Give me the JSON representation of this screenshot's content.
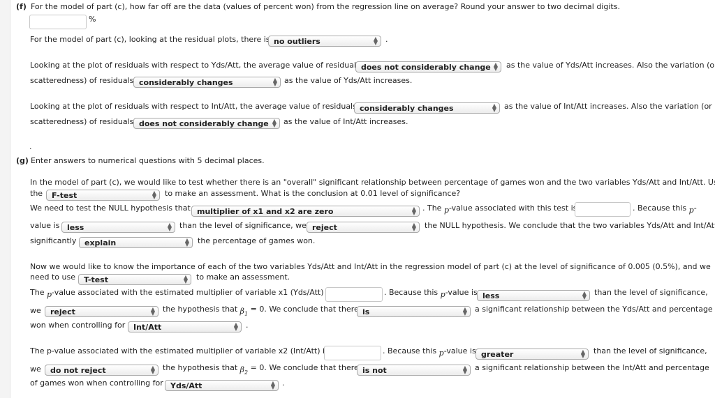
{
  "part_f": {
    "label": "(f)",
    "question": "For the model of part (c), how far off are the data (values of percent won) from the regression line on average? Round your answer to two decimal digits.",
    "answer_value": "",
    "percent_sign": "%",
    "outliers_prefix": "For the model of part (c), looking at the residual plots, there is",
    "outliers_select": "no outliers",
    "period": ".",
    "yds_line1_prefix": "Looking at the plot of residuals with respect to Yds/Att, the average value of residuals",
    "yds_avg_select": "does not considerably change",
    "yds_line1_suffix": "as the value of Yds/Att increases. Also the variation (or",
    "yds_line2_prefix": "scatteredness) of residuals",
    "yds_var_select": "considerably changes",
    "yds_line2_suffix": "as the value of Yds/Att increases.",
    "int_line1_prefix": "Looking at the plot of residuals with respect to Int/Att, the average value of residuals",
    "int_avg_select": "considerably changes",
    "int_line1_suffix": "as the value of Int/Att increases. Also the variation (or",
    "int_line2_prefix": "scatteredness) of residuals",
    "int_var_select": "does not considerably change",
    "int_line2_suffix": "as the value of Int/Att increases.",
    "dot": "."
  },
  "part_g": {
    "label": "(g)",
    "instruction": "Enter answers to numerical questions with 5 decimal places.",
    "overall_line1": "In the model of part (c), we would like to test whether there is an \"overall\" significant relationship between percentage of games won and the two variables Yds/Att and Int/Att. Use",
    "overall_the": "the",
    "test_select": "F-test",
    "overall_line2_suffix": "to make an assessment. What is the conclusion at 0.01 level of significance?",
    "null_prefix": "We need to test the NULL hypothesis that",
    "null_select": "multiplier of x1 and x2 are zero",
    "pvalue_prefix_a": ". The",
    "p_symbol": "p",
    "pvalue_prefix_b": "-value associated with this test is",
    "pvalue_input": "",
    "because_this": ". Because this",
    "dash": "-",
    "value_is": "value is",
    "compare_select": "less",
    "than_level_we": "than the level of significance, we",
    "decision_select": "reject",
    "null_conclusion": "the NULL hypothesis. We conclude that the two variables Yds/Att and Int/Att",
    "significantly": "significantly",
    "explain_select": "explain",
    "pct_games_won": "the percentage of games won.",
    "importance_line1": "Now we would like to know the importance of each of the two variables Yds/Att and Int/Att in the regression model of part (c) at the level of significance of 0.005 (0.5%), and we",
    "need_to_use": "need to use",
    "ttest_select": "T-test",
    "to_make": "to make an assessment.",
    "x1": {
      "pvalue_prefix_a": "The",
      "pvalue_prefix_b": "-value associated with the estimated multiplier of variable x1 (Yds/Att) is",
      "pvalue_input": "",
      "because_a": ". Because this",
      "because_b": "-value is",
      "compare_select": "less",
      "than_level": "than the level of significance,",
      "we": "we",
      "decision_select": "reject",
      "hyp_a": "the hypothesis that",
      "beta": "β",
      "beta_sub": "1",
      "hyp_b": "= 0. We conclude that there",
      "is_select": "is",
      "rel_text": "a significant relationship between the Yds/Att and percentage",
      "won_controlling": "won when controlling for",
      "control_select": "Int/Att",
      "period": "."
    },
    "x2": {
      "pvalue_prefix": "The p-value associated with the estimated multiplier of variable x2 (Int/Att) is",
      "pvalue_input": "",
      "because_a": ". Because this",
      "because_b": "-value is",
      "compare_select": "greater",
      "than_level": "than the level of significance,",
      "we": "we",
      "decision_select": "do not reject",
      "hyp_a": "the hypothesis that",
      "beta": "β",
      "beta_sub": "2",
      "hyp_b": "= 0. We conclude that there",
      "is_select": "is not",
      "rel_text": "a significant relationship between the Int/Att and percentage",
      "won_controlling": "of games won when controlling for",
      "control_select": "Yds/Att",
      "period": "."
    }
  }
}
